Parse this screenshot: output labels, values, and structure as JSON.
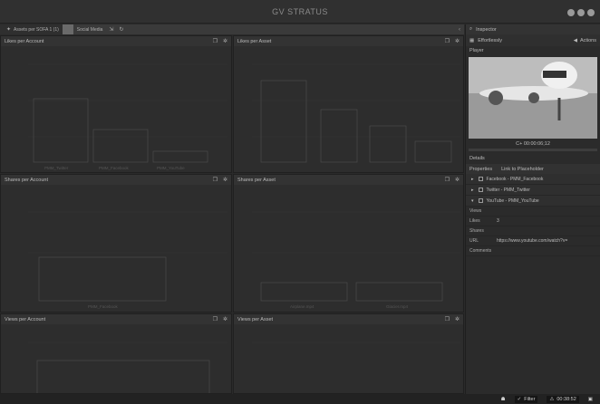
{
  "app": {
    "title": "GV STRATUS"
  },
  "tabs": [
    {
      "label": "Assets per SOFA 1 (1)",
      "active": true
    },
    {
      "label": ""
    },
    {
      "label": "Social Media"
    }
  ],
  "tab_icons": [
    "pin-icon",
    "refresh-icon"
  ],
  "panels": [
    {
      "title": "Likes per Account",
      "bars": [
        "PMM_Twitter",
        "PMM_Facebook",
        "PMM_YouTube"
      ]
    },
    {
      "title": "Likes per Asset",
      "bars": []
    },
    {
      "title": "Shares per Account",
      "bars": [
        "PMM_Facebook"
      ]
    },
    {
      "title": "Shares per Asset",
      "bars": [
        "Airplane.mp4",
        "Glacier.mp4"
      ]
    },
    {
      "title": "Views per Account",
      "bars": []
    },
    {
      "title": "Views per Asset",
      "bars": []
    }
  ],
  "right": {
    "inspector_tab": "Inspector",
    "asset_name": "Effortlessly",
    "action_label": "Actions",
    "player_tab": "Player",
    "timecode": "C+ 00:00:06;12",
    "details_tab": "Details",
    "sub_tabs": [
      "Properties",
      "Link to Placeholder"
    ],
    "links": [
      {
        "label": "Facebook - PMM_Facebook"
      },
      {
        "label": "Twitter - PMM_Twitter"
      },
      {
        "label": "YouTube - PMM_YouTube"
      }
    ],
    "props": [
      {
        "label": "Views",
        "value": ""
      },
      {
        "label": "Likes",
        "value": "3"
      },
      {
        "label": "Shares",
        "value": ""
      },
      {
        "label": "URL",
        "value": "https://www.youtube.com/watch?v="
      },
      {
        "label": "Comments",
        "value": ""
      }
    ]
  },
  "status": {
    "filter_label": "Filter",
    "time_label": "00:38:52"
  }
}
